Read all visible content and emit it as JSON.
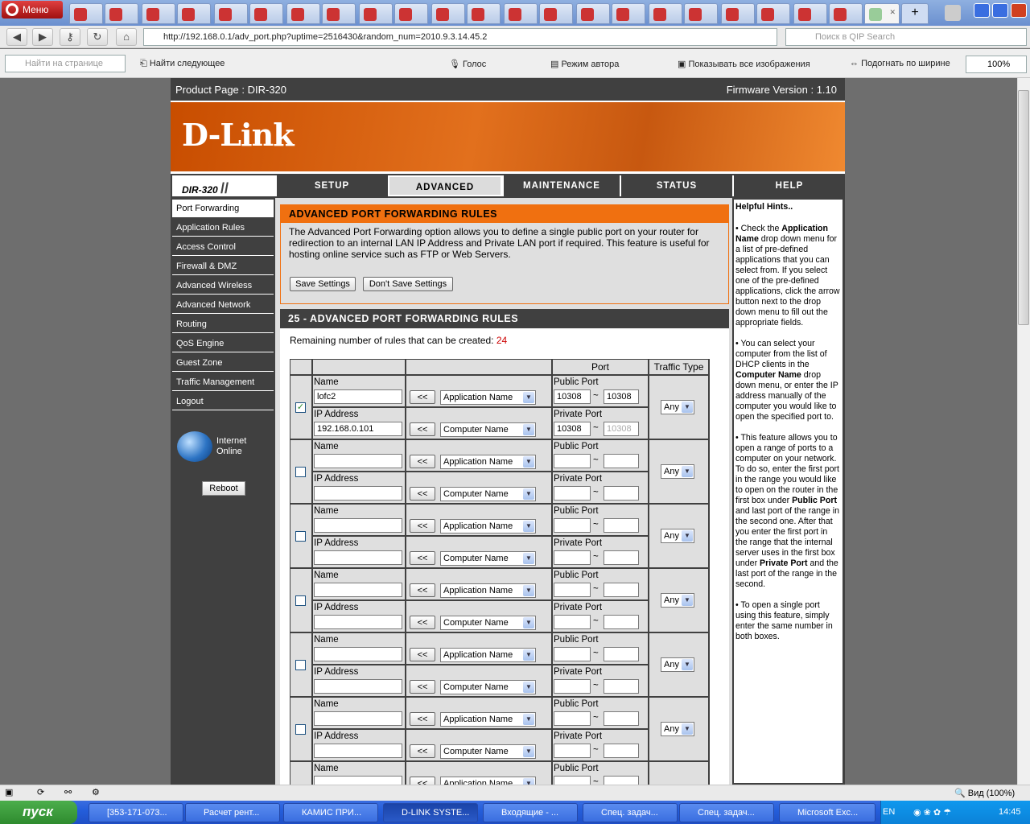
{
  "browser": {
    "menu_label": "Меню",
    "url": "http://192.168.0.1/adv_port.php?uptime=2516430&random_num=2010.9.3.14.45.2",
    "search_placeholder": "Поиск в QIP Search",
    "find_placeholder": "Найти на странице",
    "find_next": "Найти следующее",
    "voice": "Голос",
    "author_mode": "Режим автора",
    "show_images": "Показывать все изображения",
    "fit_width": "Подогнать по ширине",
    "zoom": "100%",
    "status_zoom": "Вид (100%)"
  },
  "router": {
    "product_page": "Product Page :  DIR-320",
    "firmware": "Firmware Version : 1.10",
    "brand": "D-Link",
    "model": "DIR-320",
    "tabs": [
      "SETUP",
      "ADVANCED",
      "MAINTENANCE",
      "STATUS",
      "HELP"
    ],
    "active_tab": "ADVANCED",
    "sidebar": [
      "Port Forwarding",
      "Application Rules",
      "Access Control",
      "Firewall & DMZ",
      "Advanced Wireless",
      "Advanced Network",
      "Routing",
      "QoS Engine",
      "Guest Zone",
      "Traffic Management",
      "Logout"
    ],
    "internet_status_1": "Internet",
    "internet_status_2": "Online",
    "reboot": "Reboot",
    "section_title": "ADVANCED PORT FORWARDING RULES",
    "section_text": "The Advanced Port Forwarding option allows you to define a single public port on your router for redirection to an internal LAN IP Address and Private LAN port if required. This feature is useful for hosting online service such as FTP or Web Servers.",
    "save_settings": "Save Settings",
    "dont_save": "Don't Save Settings",
    "rules_title": "25 - ADVANCED PORT FORWARDING RULES",
    "remaining_label": "Remaining number of rules that can be created:",
    "remaining_count": "24",
    "col_port": "Port",
    "col_traffic": "Traffic Type",
    "lbl_name": "Name",
    "lbl_ip": "IP Address",
    "lbl_public": "Public Port",
    "lbl_private": "Private Port",
    "arrow_btn": "<<",
    "app_name": "Application Name",
    "comp_name": "Computer Name",
    "tilde": "~",
    "traffic_any": "Any",
    "rule1": {
      "name": "lofc2",
      "ip": "192.168.0.101",
      "pub_start": "10308",
      "pub_end": "10308",
      "priv_start": "10308",
      "priv_end": "10308",
      "checked": true
    }
  },
  "hints": {
    "title": "Helpful Hints..",
    "h1": "• Check the Application Name drop down menu for a list of pre-defined applications that you can select from. If you select one of the pre-defined applications, click the arrow button next to the drop down menu to fill out the appropriate fields.",
    "h2": "• You can select your computer from the list of DHCP clients in the Computer Name drop down menu, or enter the IP address manually of the computer you would like to open the specified port to.",
    "h3": "• This feature allows you to open a range of ports to a computer on your network. To do so, enter the first port in the range you would like to open on the router in the first box under Public Port and last port of the range in the second one. After that you enter the first port in the range that the internal server uses in the first box under Private Port and the last port of the range in the second.",
    "h4": "• To open a single port using this feature, simply enter the same number in both boxes."
  },
  "taskbar": {
    "start": "пуск",
    "items": [
      "[353-171-073...",
      "Расчет рент...",
      "КАМИС ПРИ...",
      "D-LINK SYSTE...",
      "Входящие - ...",
      "Спец. задач...",
      "Спец. задач...",
      "Microsoft Exc..."
    ],
    "lang": "EN",
    "time": "14:45"
  }
}
